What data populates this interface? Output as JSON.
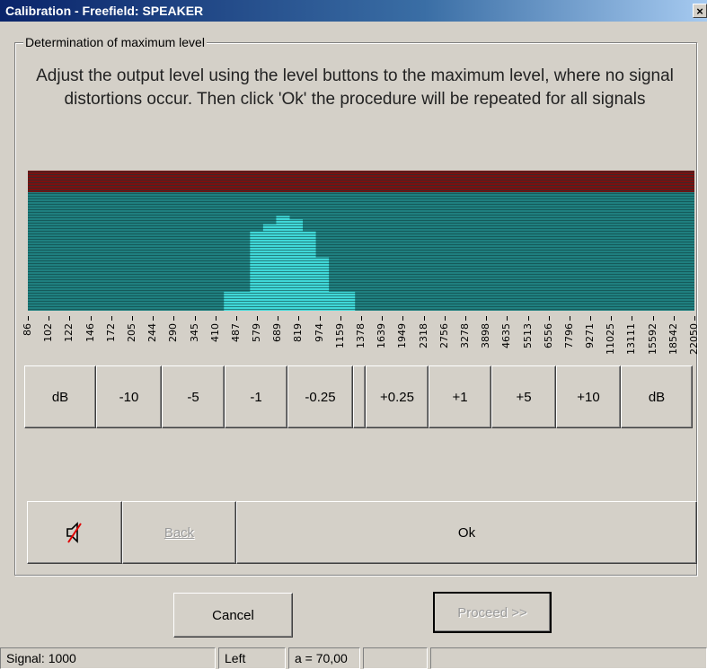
{
  "window": {
    "title": "Calibration - Freefield: SPEAKER",
    "close_label": "×"
  },
  "group": {
    "label": "Determination of maximum level",
    "instructions": "Adjust the output level using the level buttons to the maximum level, where no signal distortions occur. Then click 'Ok' the procedure will be repeated for all signals"
  },
  "spectrum": {
    "colors": {
      "background": "#1f7f7f",
      "clip_zone": "#7a1010",
      "active": "#40d8d8",
      "line": "#0c3c3c"
    },
    "levels_fraction": [
      0,
      0,
      0,
      0,
      0,
      0,
      0,
      0,
      0,
      0,
      0,
      0,
      0,
      0,
      0,
      0.16,
      0.16,
      0.67,
      0.73,
      0.8,
      0.77,
      0.67,
      0.45,
      0.16,
      0.16,
      0,
      0,
      0,
      0,
      0,
      0,
      0,
      0,
      0,
      0,
      0,
      0,
      0,
      0,
      0,
      0,
      0,
      0,
      0,
      0,
      0,
      0,
      0,
      0,
      0,
      0
    ]
  },
  "frequency_ticks": [
    "86",
    "102",
    "122",
    "146",
    "172",
    "205",
    "244",
    "290",
    "345",
    "410",
    "487",
    "579",
    "689",
    "819",
    "974",
    "1159",
    "1378",
    "1639",
    "1949",
    "2318",
    "2756",
    "3278",
    "3898",
    "4635",
    "5513",
    "6556",
    "7796",
    "9271",
    "11025",
    "13111",
    "15592",
    "18542",
    "22050"
  ],
  "level_buttons": [
    {
      "label": "dB",
      "name": "db-left-button"
    },
    {
      "label": "-10",
      "name": "minus-10-button"
    },
    {
      "label": "-5",
      "name": "minus-5-button"
    },
    {
      "label": "-1",
      "name": "minus-1-button"
    },
    {
      "label": "-0.25",
      "name": "minus-0-25-button"
    },
    {
      "label": "",
      "name": "spacer-button"
    },
    {
      "label": "+0.25",
      "name": "plus-0-25-button"
    },
    {
      "label": "+1",
      "name": "plus-1-button"
    },
    {
      "label": "+5",
      "name": "plus-5-button"
    },
    {
      "label": "+10",
      "name": "plus-10-button"
    },
    {
      "label": "dB",
      "name": "db-right-button"
    }
  ],
  "controls": {
    "mute_icon": "speaker-muted-icon",
    "back_label": "Back",
    "ok_label": "Ok"
  },
  "footer": {
    "cancel_label": "Cancel",
    "proceed_label": "Proceed >>"
  },
  "status": {
    "signal": "Signal: 1000",
    "channel": "Left",
    "level": "a = 70,00",
    "empty1": "",
    "empty2": ""
  }
}
